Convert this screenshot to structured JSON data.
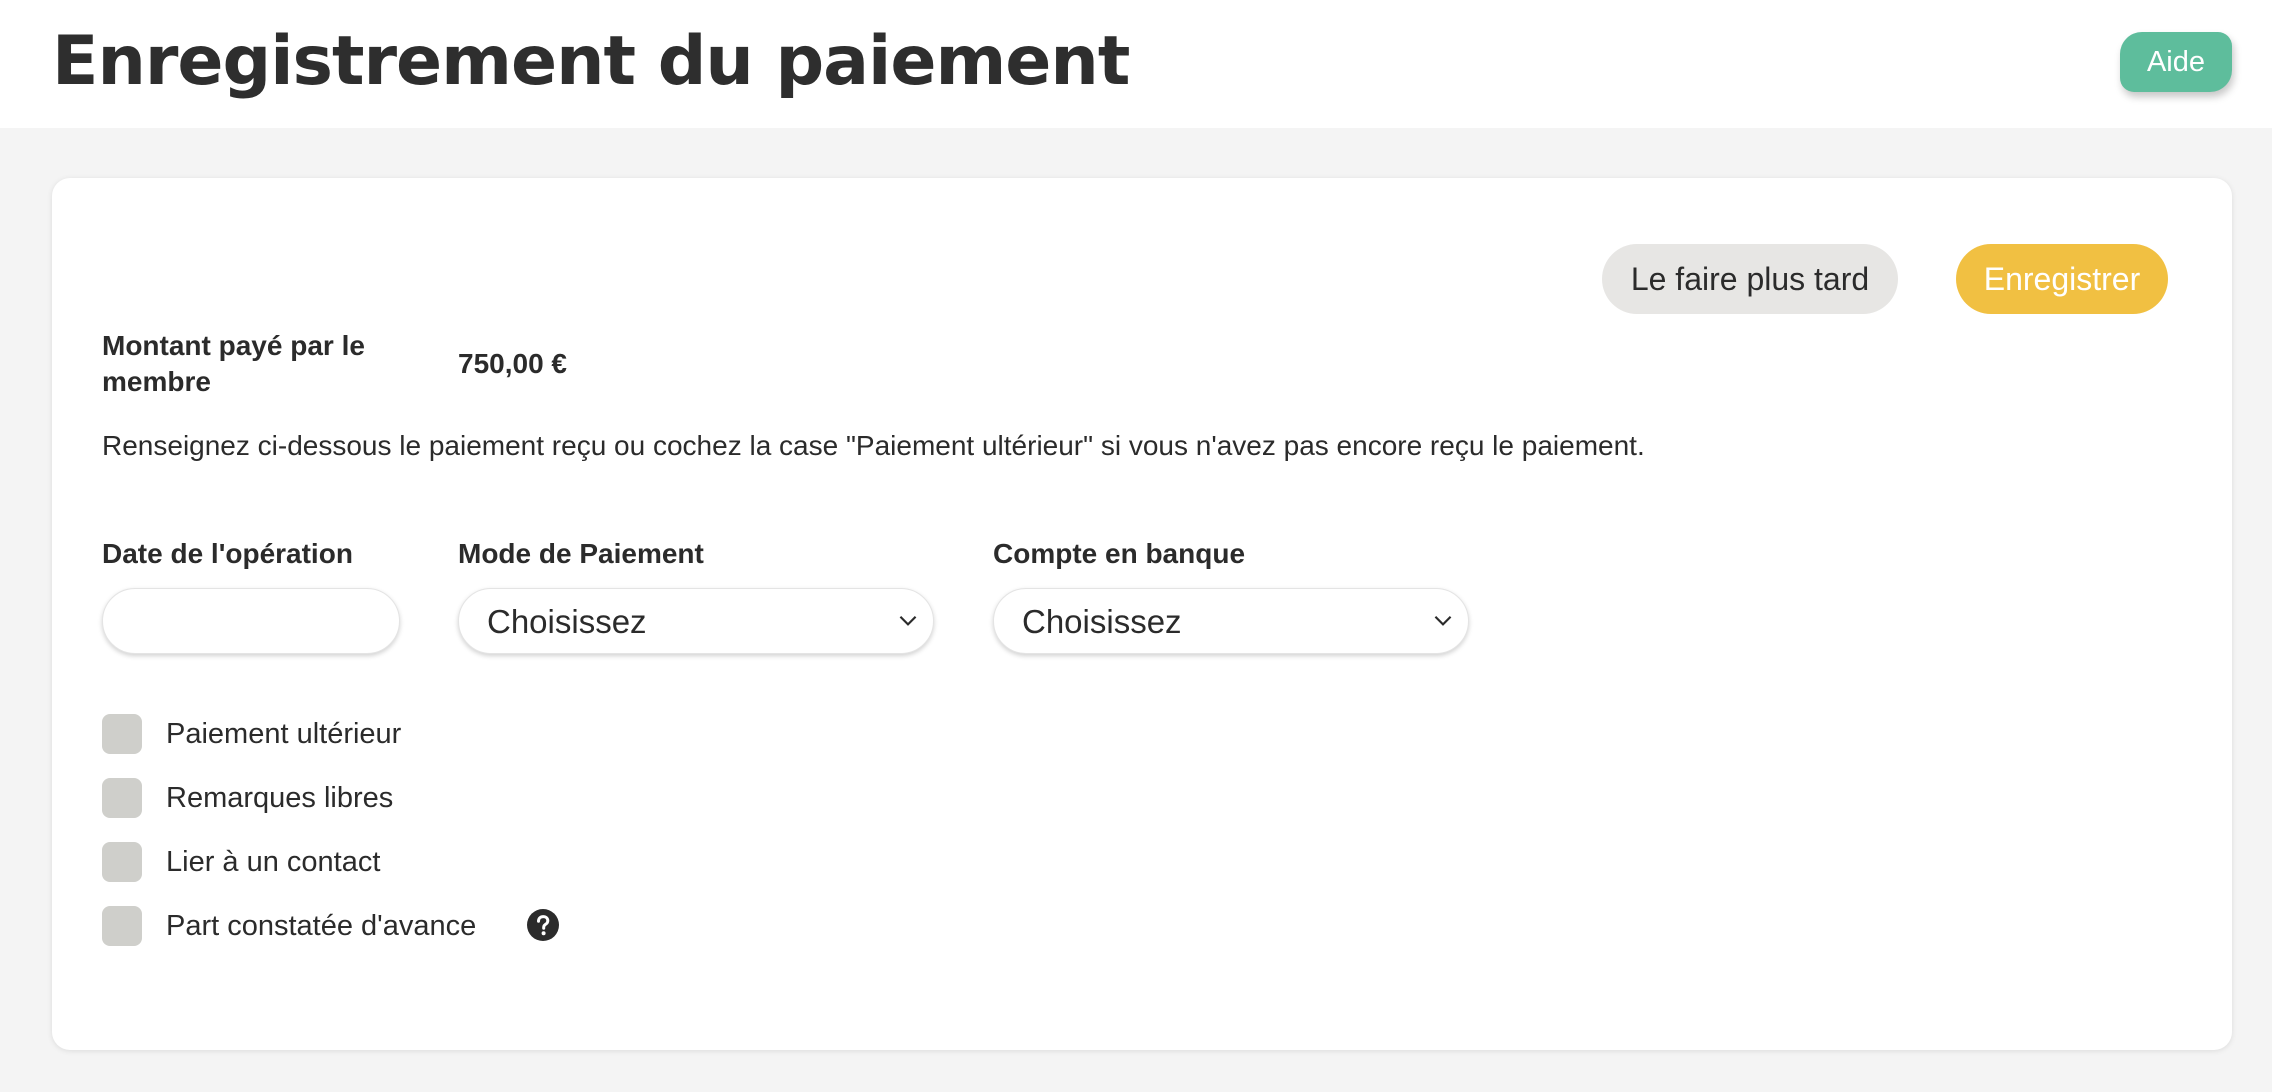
{
  "header": {
    "title": "Enregistrement du paiement",
    "help_label": "Aide"
  },
  "actions": {
    "later_label": "Le faire plus tard",
    "save_label": "Enregistrer"
  },
  "amount": {
    "label": "Montant payé par le membre",
    "value": "750,00 €"
  },
  "instructions": "Renseignez ci-dessous le paiement reçu ou cochez la case \"Paiement ultérieur\" si vous n'avez pas encore reçu le paiement.",
  "fields": {
    "date_label": "Date de l'opération",
    "date_value": "",
    "payment_mode_label": "Mode de Paiement",
    "payment_mode_value": "Choisissez",
    "bank_account_label": "Compte en banque",
    "bank_account_value": "Choisissez"
  },
  "checkboxes": [
    {
      "label": "Paiement ultérieur",
      "checked": false
    },
    {
      "label": "Remarques libres",
      "checked": false
    },
    {
      "label": "Lier à un contact",
      "checked": false
    },
    {
      "label": "Part constatée d'avance",
      "checked": false,
      "icon": "question-circle-icon"
    }
  ],
  "colors": {
    "help_button": "#5ebd9c",
    "save_button": "#f1c042",
    "later_button": "#e7e6e4",
    "checkbox": "#cfcfcb"
  }
}
